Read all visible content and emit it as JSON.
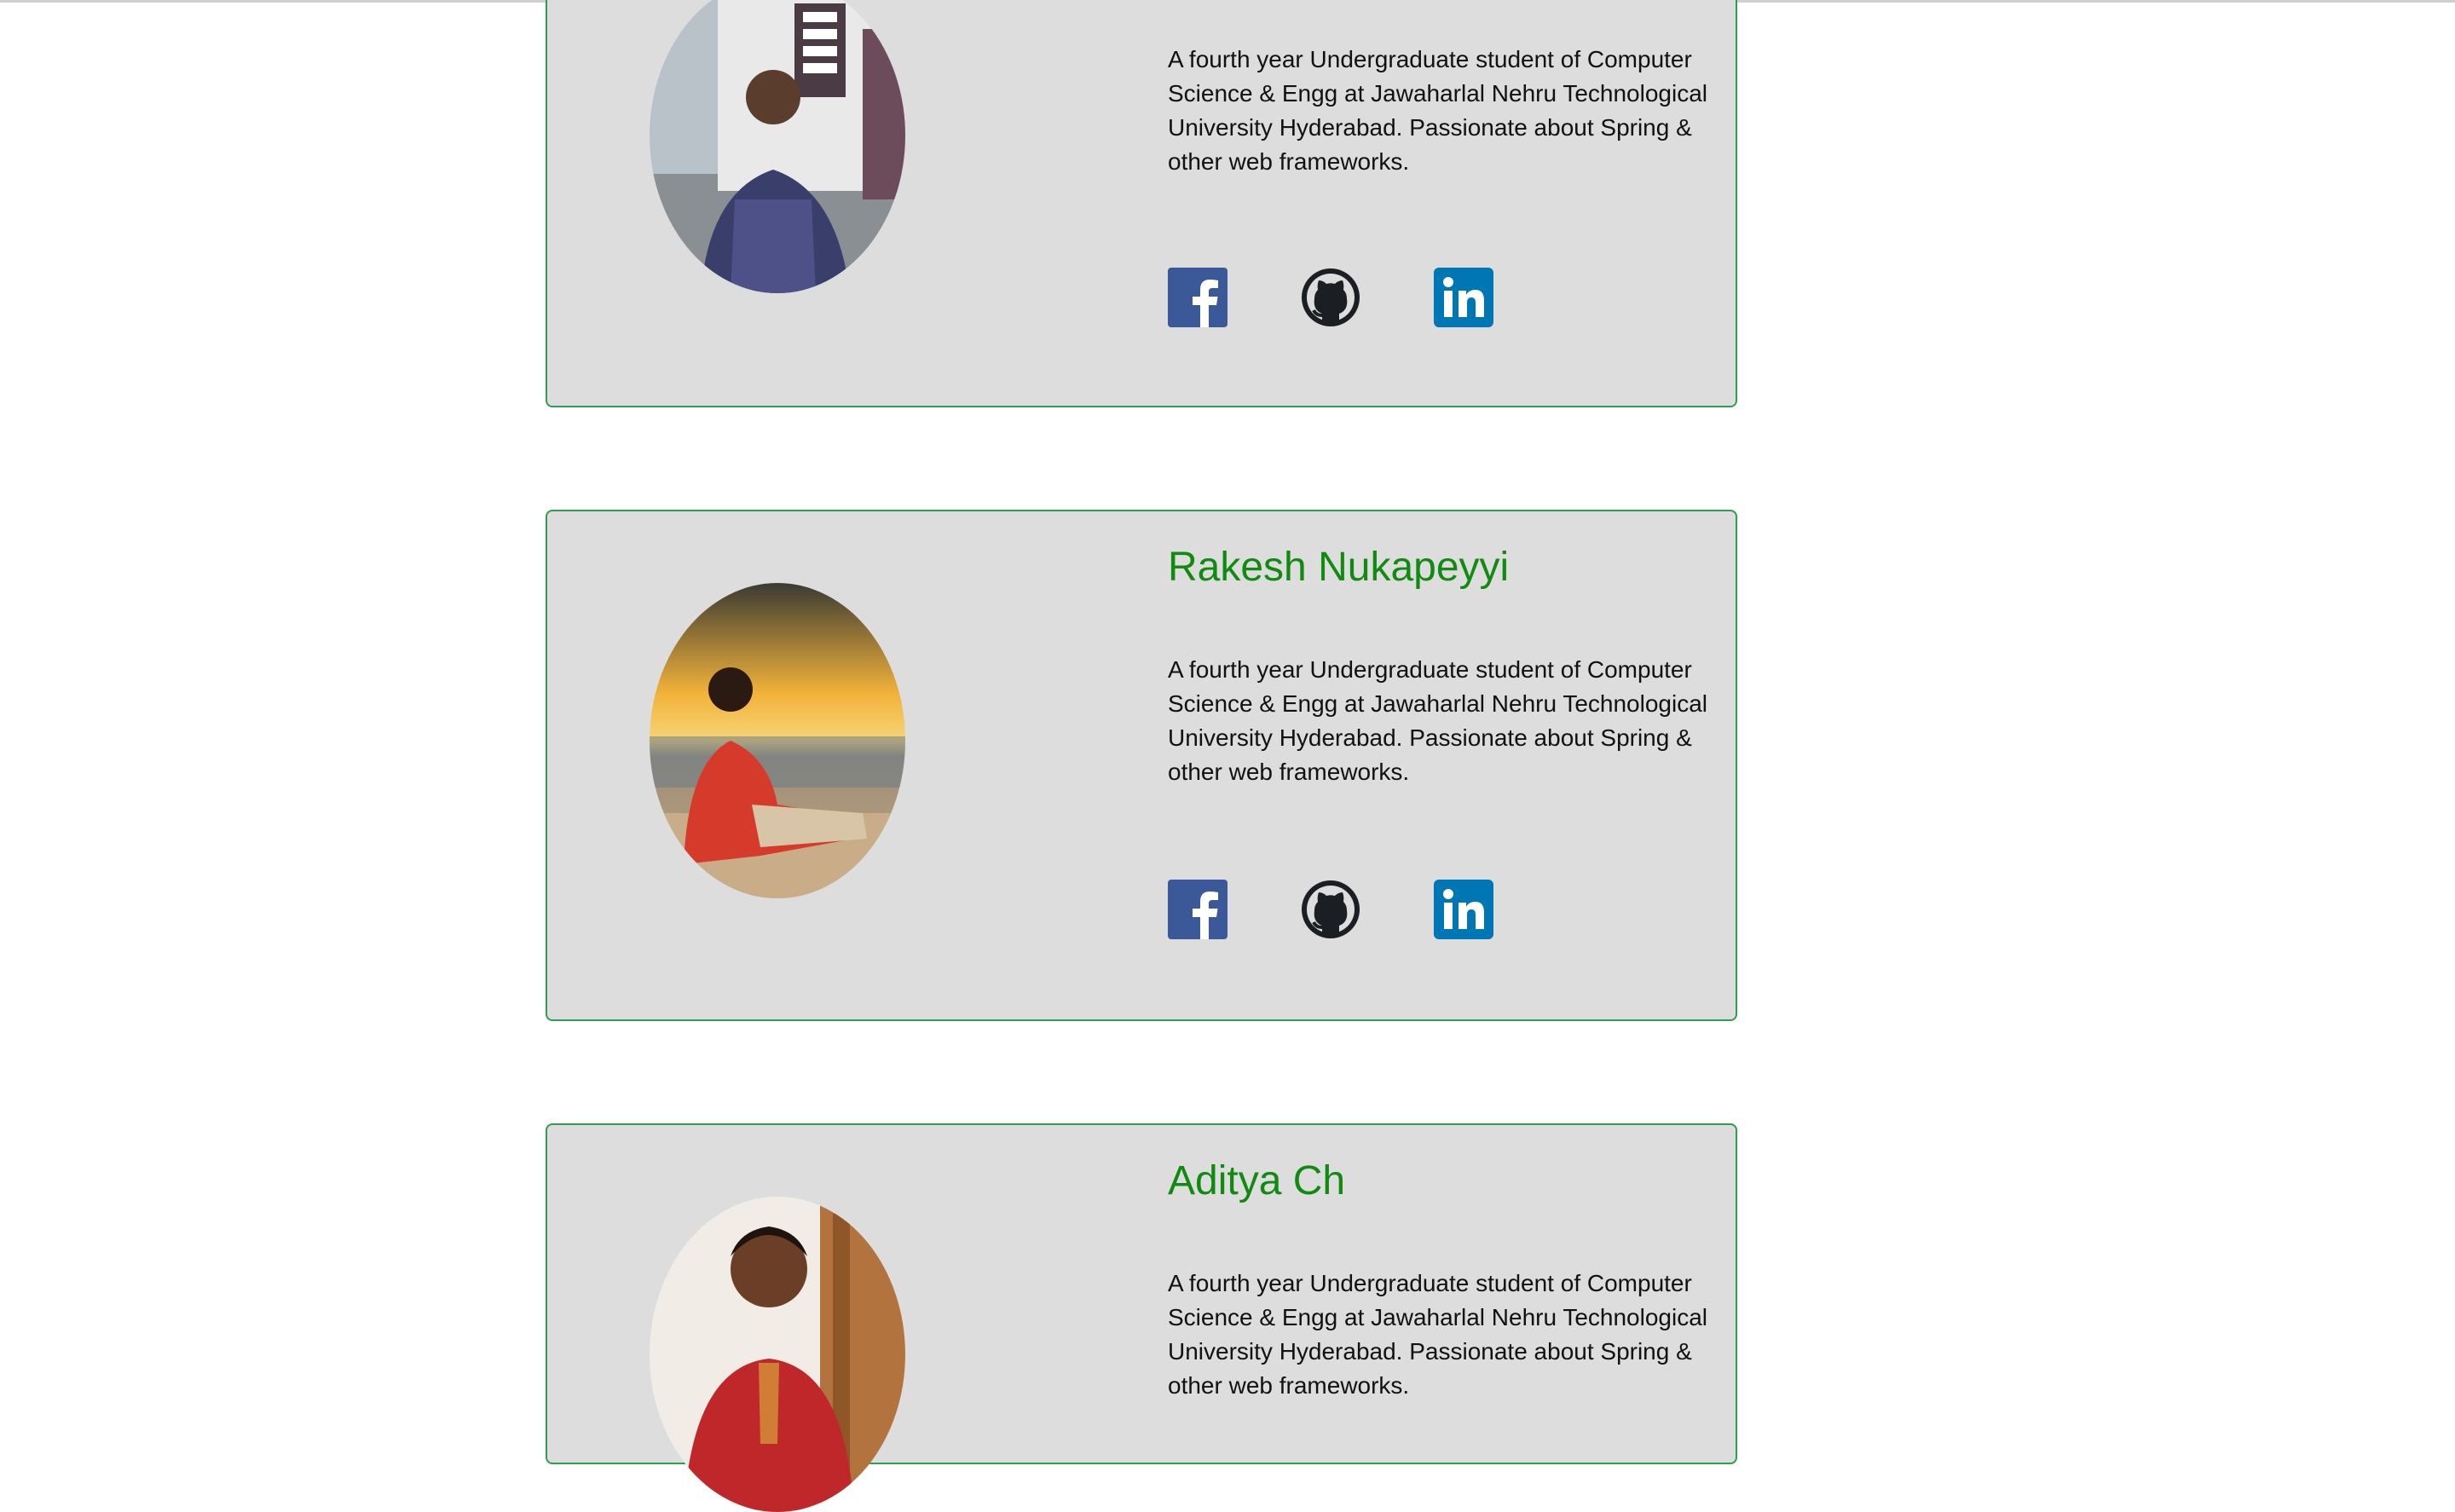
{
  "colors": {
    "card_background": "#dddddd",
    "card_border": "#2e9e4f",
    "name_color": "#108a10",
    "facebook": "#3b5998",
    "github": "#1b1f23",
    "linkedin": "#0077b5"
  },
  "members": [
    {
      "name": "",
      "bio": "A fourth year Undergraduate student of Computer Science & Engg at Jawaharlal Nehru Technological University Hyderabad. Passionate about Spring & other web frameworks.",
      "social": [
        {
          "icon": "facebook-icon",
          "label": "Facebook"
        },
        {
          "icon": "github-icon",
          "label": "GitHub"
        },
        {
          "icon": "linkedin-icon",
          "label": "LinkedIn"
        }
      ]
    },
    {
      "name": "Rakesh Nukapeyyi",
      "bio": "A fourth year Undergraduate student of Computer Science & Engg at Jawaharlal Nehru Technological University Hyderabad. Passionate about Spring & other web frameworks.",
      "social": [
        {
          "icon": "facebook-icon",
          "label": "Facebook"
        },
        {
          "icon": "github-icon",
          "label": "GitHub"
        },
        {
          "icon": "linkedin-icon",
          "label": "LinkedIn"
        }
      ]
    },
    {
      "name": "Aditya Ch",
      "bio": "A fourth year Undergraduate student of Computer Science & Engg at Jawaharlal Nehru Technological University Hyderabad. Passionate about Spring & other web frameworks."
    }
  ]
}
